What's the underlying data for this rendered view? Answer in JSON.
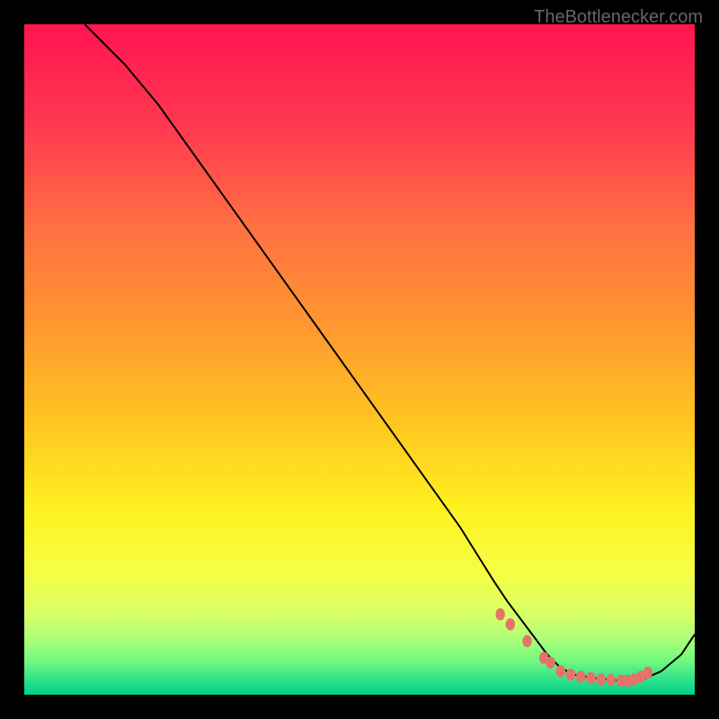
{
  "watermark": "TheBottlenecker.com",
  "chart_data": {
    "type": "line",
    "title": "",
    "xlabel": "",
    "ylabel": "",
    "xlim": [
      0,
      100
    ],
    "ylim": [
      0,
      100
    ],
    "curve": {
      "x": [
        9,
        10,
        12,
        15,
        20,
        25,
        30,
        35,
        40,
        45,
        50,
        55,
        60,
        65,
        70,
        72,
        75,
        78,
        80,
        82,
        85,
        88,
        90,
        92,
        95,
        98,
        100
      ],
      "y": [
        100,
        99,
        97,
        94,
        88,
        81,
        74,
        67,
        60,
        53,
        46,
        39,
        32,
        25,
        17,
        14,
        10,
        6,
        4,
        3,
        2.5,
        2.2,
        2,
        2.2,
        3.5,
        6,
        9
      ]
    },
    "markers": {
      "x": [
        71,
        72.5,
        75,
        77.5,
        78.5,
        80,
        81.5,
        83,
        84.5,
        86,
        87.5,
        89,
        90,
        91,
        92,
        93
      ],
      "y": [
        12,
        10.5,
        8,
        5.5,
        4.8,
        3.5,
        3,
        2.7,
        2.5,
        2.3,
        2.2,
        2.1,
        2.1,
        2.3,
        2.7,
        3.3
      ]
    },
    "gradient_stops": [
      {
        "offset": 0,
        "color": "#ff1451"
      },
      {
        "offset": 15,
        "color": "#ff3850"
      },
      {
        "offset": 30,
        "color": "#ff6f42"
      },
      {
        "offset": 45,
        "color": "#ff9830"
      },
      {
        "offset": 60,
        "color": "#ffc720"
      },
      {
        "offset": 72,
        "color": "#fff020"
      },
      {
        "offset": 82,
        "color": "#f5ff44"
      },
      {
        "offset": 88,
        "color": "#d8ff68"
      },
      {
        "offset": 92,
        "color": "#a8ff78"
      },
      {
        "offset": 95,
        "color": "#70f880"
      },
      {
        "offset": 97,
        "color": "#40e888"
      },
      {
        "offset": 99,
        "color": "#15d88a"
      },
      {
        "offset": 100,
        "color": "#00cc88"
      }
    ]
  }
}
